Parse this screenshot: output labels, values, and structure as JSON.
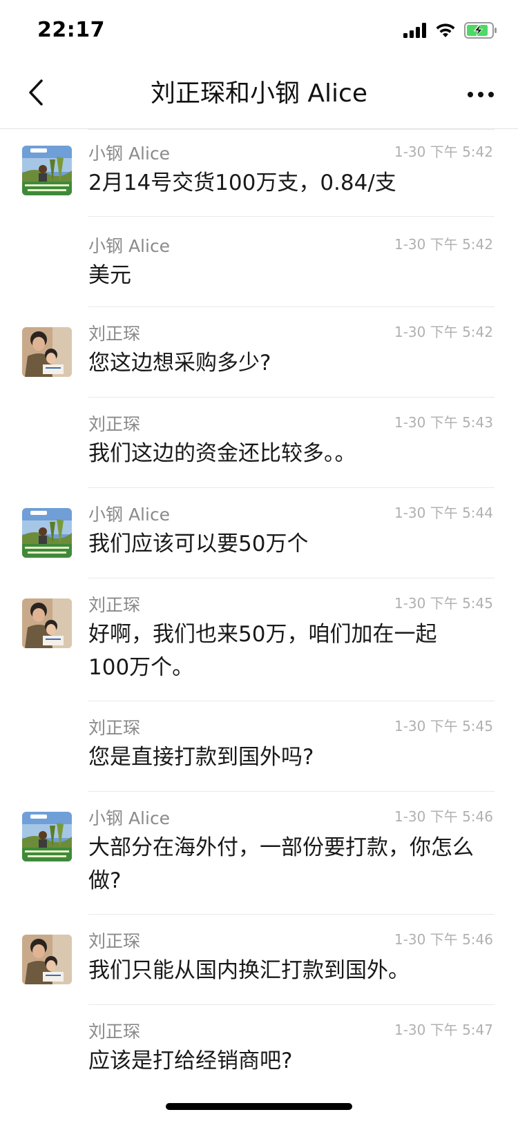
{
  "status_bar": {
    "time": "22:17",
    "signal_icon": "cellular-signal-icon",
    "wifi_icon": "wifi-icon",
    "battery_icon": "battery-charging-icon"
  },
  "nav": {
    "title": "刘正琛和小钢 Alice",
    "back_icon": "chevron-left-icon",
    "more_icon": "more-horizontal-icon"
  },
  "messages": [
    {
      "sender": "小钢 Alice",
      "time": "1-30 下午 5:42",
      "text": "2月14号交货100万支，0.84/支",
      "avatar": "alice"
    },
    {
      "sender": "小钢 Alice",
      "time": "1-30 下午 5:42",
      "text": "美元",
      "avatar": ""
    },
    {
      "sender": "刘正琛",
      "time": "1-30 下午 5:42",
      "text": "您这边想采购多少?",
      "avatar": "liu"
    },
    {
      "sender": "刘正琛",
      "time": "1-30 下午 5:43",
      "text": "我们这边的资金还比较多。。",
      "avatar": ""
    },
    {
      "sender": "小钢 Alice",
      "time": "1-30 下午 5:44",
      "text": "我们应该可以要50万个",
      "avatar": "alice"
    },
    {
      "sender": "刘正琛",
      "time": "1-30 下午 5:45",
      "text": "好啊，我们也来50万，咱们加在一起100万个。",
      "avatar": "liu"
    },
    {
      "sender": "刘正琛",
      "time": "1-30 下午 5:45",
      "text": "您是直接打款到国外吗?",
      "avatar": ""
    },
    {
      "sender": "小钢 Alice",
      "time": "1-30 下午 5:46",
      "text": "大部分在海外付，一部份要打款，你怎么做?",
      "avatar": "alice"
    },
    {
      "sender": "刘正琛",
      "time": "1-30 下午 5:46",
      "text": "我们只能从国内换汇打款到国外。",
      "avatar": "liu"
    },
    {
      "sender": "刘正琛",
      "time": "1-30 下午 5:47",
      "text": "应该是打给经销商吧?",
      "avatar": ""
    }
  ],
  "colors": {
    "text_primary": "#191919",
    "text_secondary": "#8a8a8a",
    "time": "#b0b0b0",
    "divider": "#e8e8e8",
    "battery_green": "#4cd964"
  }
}
